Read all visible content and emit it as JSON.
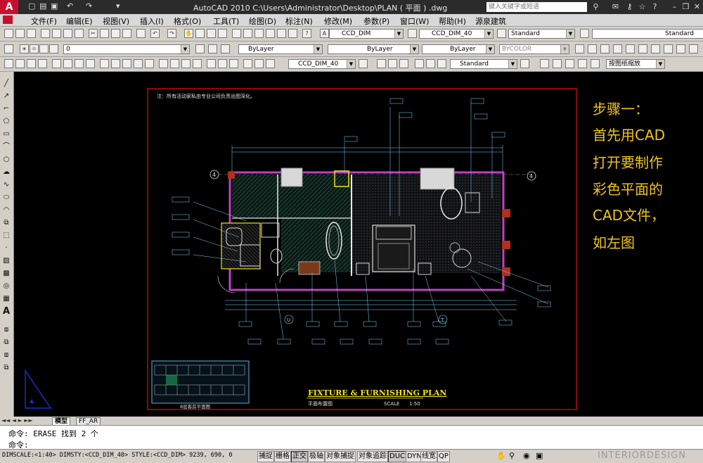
{
  "window": {
    "title": "AutoCAD 2010      C:\\Users\\Administrator\\Desktop\\PLAN ( 平面 ) .dwg",
    "search_placeholder": "键入关键字或短语"
  },
  "menu": [
    "文件(F)",
    "编辑(E)",
    "视图(V)",
    "插入(I)",
    "格式(O)",
    "工具(T)",
    "绘图(D)",
    "标注(N)",
    "修改(M)",
    "参数(P)",
    "窗口(W)",
    "帮助(H)",
    "源泉建筑"
  ],
  "toolbar1": {
    "text_style": "CCD_DIM",
    "dim_style": "CCD_DIM_40",
    "table_style": "Standard",
    "multileader_style": "Standard"
  },
  "toolbar2": {
    "layer": "0",
    "color": "ByLayer",
    "linetype": "ByLayer",
    "lineweight": "ByLayer",
    "plotstyle": "BYCOLOR"
  },
  "toolbar3": {
    "dim_style": "CCD_DIM_40",
    "text_style": "Standard",
    "viewport_scale": "按图纸缩放"
  },
  "drawing": {
    "note": "注：所有活动家私由专业公司负责出图深化。",
    "plan_title": "FIXTURE & FURNISHING PLAN",
    "plan_subtitle": "平面布置图",
    "scale_label": "SCALE",
    "scale_value": "1:50",
    "key_plan_caption": "8层客房平面图",
    "section_marks": [
      "U",
      "T"
    ],
    "grid_numbers": [
      "4",
      "4"
    ]
  },
  "annotation": {
    "lines": [
      "步骤一：",
      "首先用CAD",
      "打开要制作",
      "彩色平面的",
      "CAD文件，",
      "如左图"
    ]
  },
  "tabs": [
    "模型",
    "FF_AR"
  ],
  "command": {
    "history": "命令:  ERASE 找到 2 个",
    "prompt": "命令:"
  },
  "status": {
    "readout": "DIMSCALE:<1:40> DIMSTY:<CCD_DIM_40> STYLE:<CCD_DIM>  9239, 690, 0",
    "buttons": [
      "捕捉",
      "栅格",
      "正交",
      "极轴",
      "对象捕捉",
      "对象追踪",
      "DUCS",
      "DYN",
      "线宽",
      "QP"
    ],
    "active": [
      "正交",
      "DUCS"
    ]
  },
  "watermark": "INTERIORDESIGN"
}
